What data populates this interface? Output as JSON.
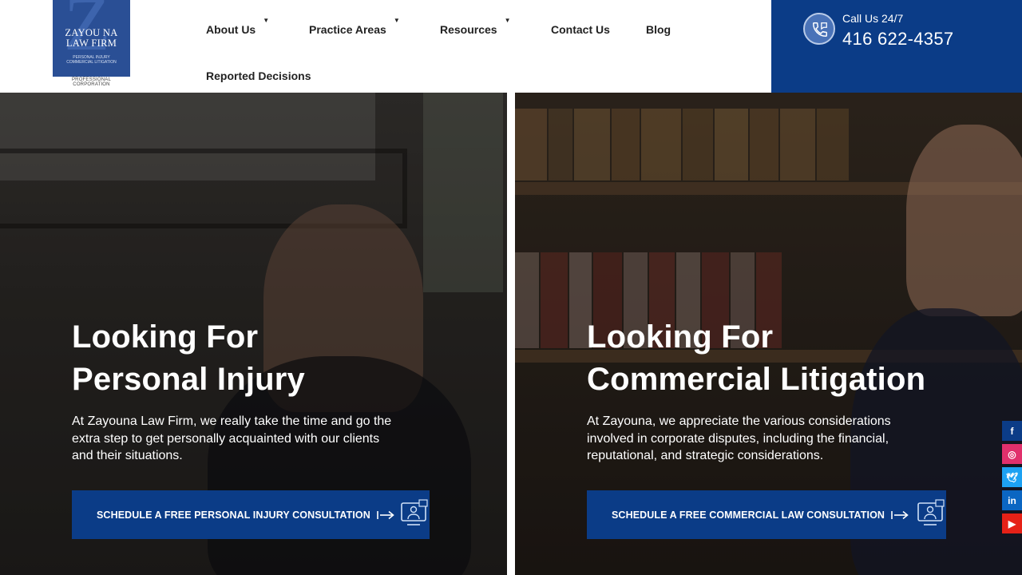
{
  "logo": {
    "name_line1": "ZAYOU NA",
    "name_line2": "LAW FIRM",
    "sub_line1": "PERSONAL INJURY",
    "sub_line2": "COMMERCIAL LITIGATION",
    "corp": "PROFESSIONAL CORPORATION",
    "brand_color": "#2a4f95"
  },
  "nav": {
    "items": [
      {
        "label": "About Us",
        "dropdown": true
      },
      {
        "label": "Practice Areas",
        "dropdown": true
      },
      {
        "label": "Resources",
        "dropdown": true
      },
      {
        "label": "Contact Us",
        "dropdown": false
      },
      {
        "label": "Blog",
        "dropdown": false
      },
      {
        "label": "Reported Decisions",
        "dropdown": false
      }
    ],
    "caret": "▼"
  },
  "call": {
    "label": "Call Us 24/7",
    "number": "416 622-4357",
    "icon": "phone-icon",
    "bg_color": "#0b3c87"
  },
  "panels": {
    "left": {
      "title_line1": "Looking For",
      "title_line2": "Personal Injury",
      "text_line1": "At Zayouna Law Firm, we really take the time and go the",
      "text_line2": "extra step to get personally acquainted with our clients",
      "text_line3": "and their situations.",
      "cta_label": "SCHEDULE A FREE PERSONAL INJURY CONSULTATION"
    },
    "right": {
      "title_line1": "Looking For",
      "title_line2": "Commercial Litigation",
      "text_line1": "At Zayouna, we appreciate the various considerations",
      "text_line2": "involved in corporate disputes, including the financial,",
      "text_line3": "reputational, and strategic considerations.",
      "cta_label": "SCHEDULE A FREE COMMERCIAL LAW CONSULTATION"
    }
  },
  "social": [
    {
      "name": "facebook-icon",
      "glyph": "f",
      "color": "#0b3c87"
    },
    {
      "name": "instagram-icon",
      "glyph": "◎",
      "color": "#e1306c"
    },
    {
      "name": "twitter-icon",
      "glyph": "🕊",
      "color": "#1da1f2"
    },
    {
      "name": "linkedin-icon",
      "glyph": "in",
      "color": "#0b66c2"
    },
    {
      "name": "youtube-icon",
      "glyph": "▶",
      "color": "#e62117"
    }
  ]
}
